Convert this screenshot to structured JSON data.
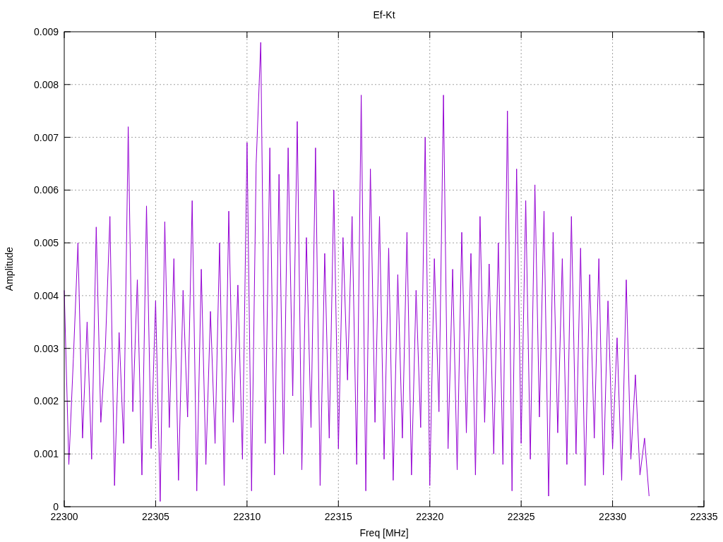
{
  "chart_data": {
    "type": "line",
    "title": "Ef-Kt",
    "xlabel": "Freq [MHz]",
    "ylabel": "Amplitude",
    "grid": true,
    "xlim": [
      22300,
      22335
    ],
    "ylim": [
      0,
      0.009
    ],
    "xticks": [
      22300,
      22305,
      22310,
      22315,
      22320,
      22325,
      22330,
      22335
    ],
    "yticks": [
      {
        "value": 0,
        "label": "0"
      },
      {
        "value": 0.001,
        "label": "0.001"
      },
      {
        "value": 0.002,
        "label": "0.002"
      },
      {
        "value": 0.003,
        "label": "0.003"
      },
      {
        "value": 0.004,
        "label": "0.004"
      },
      {
        "value": 0.005,
        "label": "0.005"
      },
      {
        "value": 0.006,
        "label": "0.006"
      },
      {
        "value": 0.007,
        "label": "0.007"
      },
      {
        "value": 0.008,
        "label": "0.008"
      },
      {
        "value": 0.009,
        "label": "0.009"
      }
    ],
    "x": [
      22300,
      22300.25,
      22300.5,
      22300.75,
      22301,
      22301.25,
      22301.5,
      22301.75,
      22302,
      22302.25,
      22302.5,
      22302.75,
      22303,
      22303.25,
      22303.5,
      22303.75,
      22304,
      22304.25,
      22304.5,
      22304.75,
      22305,
      22305.25,
      22305.5,
      22305.75,
      22306,
      22306.25,
      22306.5,
      22306.75,
      22307,
      22307.25,
      22307.5,
      22307.75,
      22308,
      22308.25,
      22308.5,
      22308.75,
      22309,
      22309.25,
      22309.5,
      22309.75,
      22310,
      22310.25,
      22310.5,
      22310.75,
      22311,
      22311.25,
      22311.5,
      22311.75,
      22312,
      22312.25,
      22312.5,
      22312.75,
      22313,
      22313.25,
      22313.5,
      22313.75,
      22314,
      22314.25,
      22314.5,
      22314.75,
      22315,
      22315.25,
      22315.5,
      22315.75,
      22316,
      22316.25,
      22316.5,
      22316.75,
      22317,
      22317.25,
      22317.5,
      22317.75,
      22318,
      22318.25,
      22318.5,
      22318.75,
      22319,
      22319.25,
      22319.5,
      22319.75,
      22320,
      22320.25,
      22320.5,
      22320.75,
      22321,
      22321.25,
      22321.5,
      22321.75,
      22322,
      22322.25,
      22322.5,
      22322.75,
      22323,
      22323.25,
      22323.5,
      22323.75,
      22324,
      22324.25,
      22324.5,
      22324.75,
      22325,
      22325.25,
      22325.5,
      22325.75,
      22326,
      22326.25,
      22326.5,
      22326.75,
      22327,
      22327.25,
      22327.5,
      22327.75,
      22328,
      22328.25,
      22328.5,
      22328.75,
      22329,
      22329.25,
      22329.5,
      22329.75,
      22330,
      22330.25,
      22330.5,
      22330.75,
      22331,
      22331.25,
      22331.5,
      22331.75,
      22332
    ],
    "series": [
      {
        "color": "#9400d3",
        "values": [
          0.0041,
          0.0008,
          0.0028,
          0.005,
          0.0013,
          0.0035,
          0.0009,
          0.0053,
          0.0016,
          0.003,
          0.0055,
          0.0004,
          0.0033,
          0.0012,
          0.0072,
          0.0018,
          0.0043,
          0.0006,
          0.0057,
          0.0011,
          0.0039,
          0.0001,
          0.0054,
          0.0015,
          0.0047,
          0.0005,
          0.0041,
          0.0017,
          0.0058,
          0.0003,
          0.0045,
          0.0008,
          0.0037,
          0.0012,
          0.005,
          0.0004,
          0.0056,
          0.0016,
          0.0042,
          0.0009,
          0.0069,
          0.0003,
          0.0065,
          0.0088,
          0.0012,
          0.0068,
          0.0006,
          0.0063,
          0.001,
          0.0068,
          0.0021,
          0.0073,
          0.0007,
          0.0051,
          0.0015,
          0.0068,
          0.0004,
          0.0048,
          0.0013,
          0.006,
          0.0011,
          0.0051,
          0.0024,
          0.0055,
          0.0008,
          0.0078,
          0.0003,
          0.0064,
          0.0016,
          0.0055,
          0.0009,
          0.0049,
          0.0005,
          0.0044,
          0.0013,
          0.0052,
          0.0006,
          0.0041,
          0.0015,
          0.007,
          0.0004,
          0.0047,
          0.0018,
          0.0078,
          0.0011,
          0.0045,
          0.0007,
          0.0052,
          0.0014,
          0.0048,
          0.0006,
          0.0055,
          0.0016,
          0.0046,
          0.001,
          0.005,
          0.0008,
          0.0075,
          0.0003,
          0.0064,
          0.0012,
          0.0058,
          0.0009,
          0.0061,
          0.0017,
          0.0056,
          0.0002,
          0.0052,
          0.0014,
          0.0047,
          0.0008,
          0.0055,
          0.001,
          0.0049,
          0.0004,
          0.0044,
          0.0013,
          0.0047,
          0.0006,
          0.0039,
          0.0011,
          0.0032,
          0.0005,
          0.0043,
          0.0009,
          0.0025,
          0.0006,
          0.0013,
          0.0002
        ]
      }
    ]
  }
}
